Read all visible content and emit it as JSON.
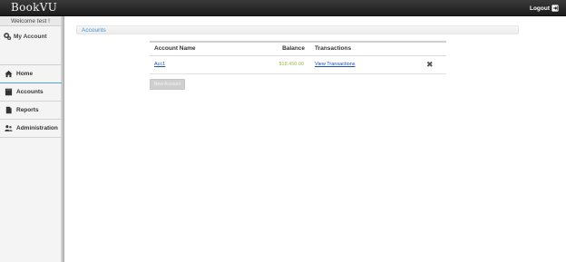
{
  "header": {
    "brand": "BookVU",
    "logout_label": "Logout",
    "logout_icon": "logout-icon"
  },
  "sidebar": {
    "welcome": "Welcome test !",
    "my_account": {
      "label": "My Account",
      "icon": "user-gear-icon"
    },
    "items": [
      {
        "label": "Home",
        "icon": "home-icon",
        "active": true
      },
      {
        "label": "Accounts",
        "icon": "book-icon",
        "active": false
      },
      {
        "label": "Reports",
        "icon": "document-icon",
        "active": false
      },
      {
        "label": "Administration",
        "icon": "users-icon",
        "active": false
      }
    ]
  },
  "main": {
    "title": "Accounts",
    "table": {
      "columns": [
        "Account Name",
        "Balance",
        "Transactions",
        ""
      ],
      "rows": [
        {
          "name": "Acc1",
          "balance": "$18,450.00",
          "transactions": "View Transactions",
          "delete_icon": "delete-icon"
        }
      ]
    },
    "new_account_label": "New Account"
  },
  "colors": {
    "accent": "#3b95d3",
    "balance": "#9bbf4a",
    "link": "#1a4fb5"
  }
}
